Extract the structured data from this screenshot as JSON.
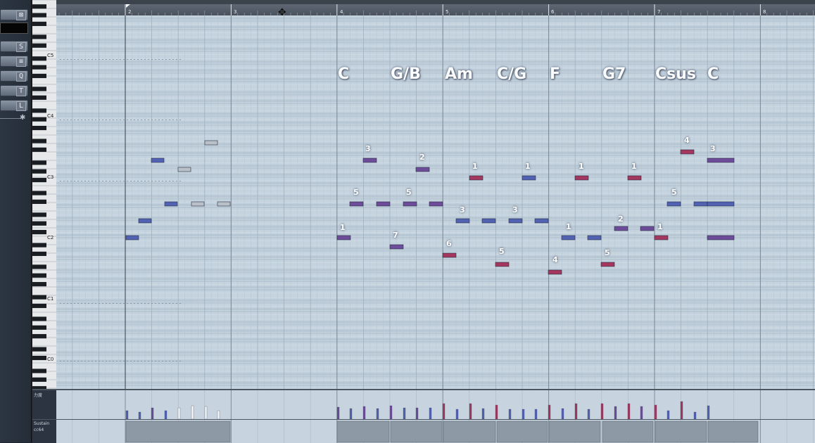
{
  "toolbar": {
    "icons": [
      "mute-icon",
      "stretch-icon",
      "quantize-icon",
      "q-icon",
      "t-icon",
      "l-icon"
    ],
    "icon_glyphs": [
      "⊠",
      "S",
      "≡",
      "Q",
      "T",
      "L"
    ]
  },
  "keyboard": {
    "octave_labels": [
      "C5",
      "C4",
      "C3",
      "C2",
      "C1",
      "C0"
    ]
  },
  "ruler": {
    "bars": [
      "2",
      "3",
      "4",
      "5",
      "6",
      "7",
      "8"
    ]
  },
  "chords": [
    "C",
    "G/B",
    "Am",
    "C/G",
    "F",
    "G7",
    "Csus",
    "C"
  ],
  "fingerings": [
    "3",
    "2",
    "1",
    "1",
    "1",
    "1",
    "4",
    "3",
    "5",
    "5",
    "5",
    "3",
    "3",
    "2",
    "1",
    "1",
    "1",
    "7",
    "6",
    "5",
    "4",
    "5"
  ],
  "lanes": {
    "velocity_label": "力度",
    "sustain_label": "Sustain",
    "sustain_cc": "cc64"
  },
  "colors": {
    "note_blue": "#5162b3",
    "note_purple": "#6d4c9a",
    "note_magenta": "#a3375e",
    "note_gray": "#b9c0c7",
    "grid_bg": "#c5d3df",
    "sustain_block": "#8d9aa6"
  }
}
